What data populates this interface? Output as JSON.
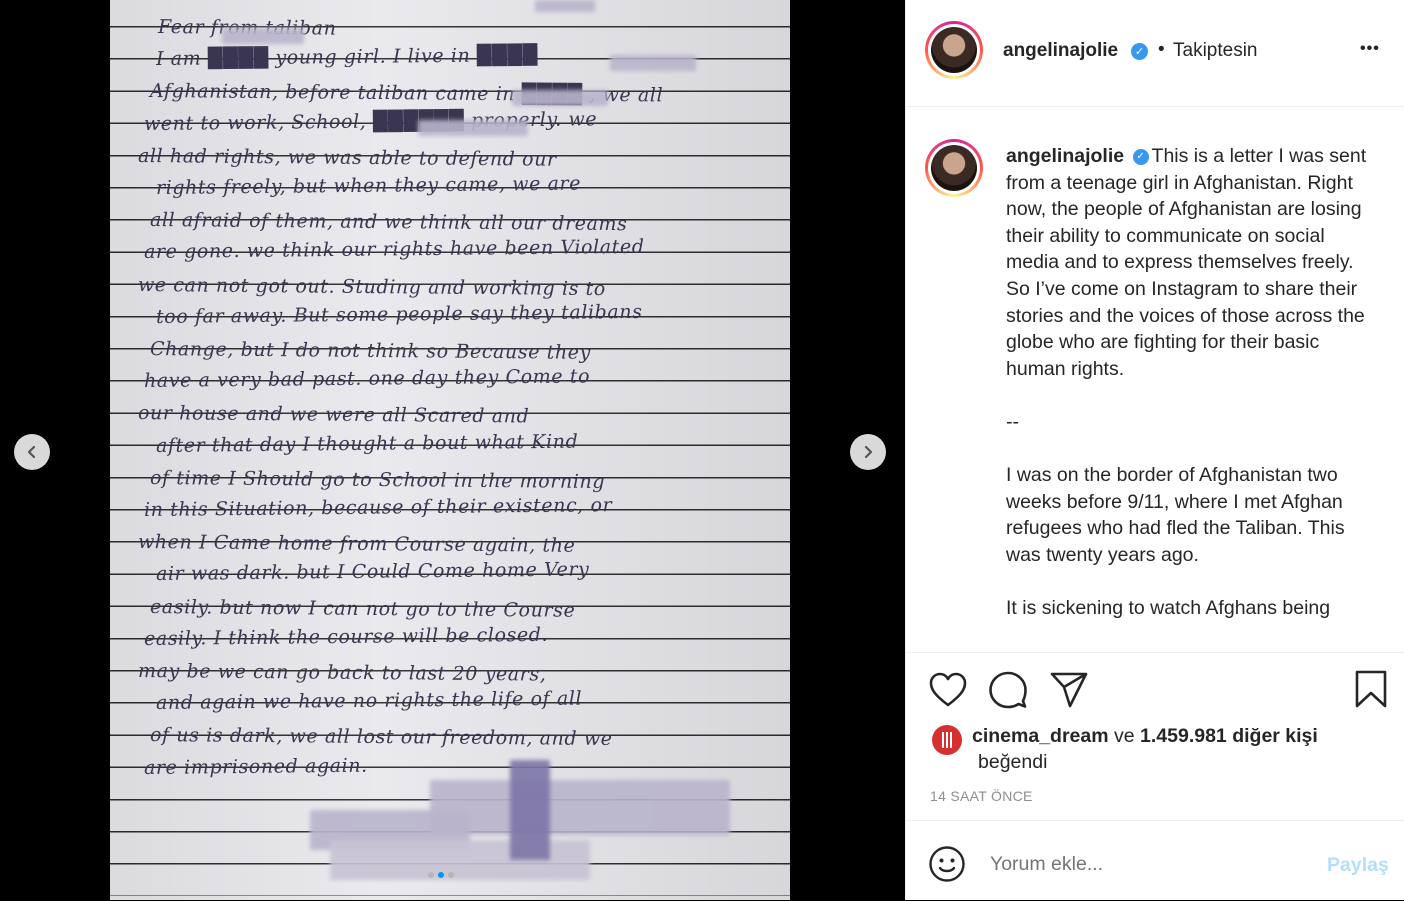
{
  "post": {
    "username": "angelinajolie",
    "follow_status": "Takiptesin",
    "more_label": "•••"
  },
  "handwriting": {
    "lines": [
      "Fear from taliban",
      "I am  ████  young girl. I live in ████",
      "Afghanistan, before taliban came in ████ , we all",
      "went to work, School, ██████ properly. we",
      "all had rights, we was able to defend our",
      "rights freely, but when they came, we are",
      "all afraid of them, and we think all our dreams",
      "are gone. we think our rights have been Violated",
      "we can not got out. Studing and working is to",
      "too far away. But some people say they talibans",
      "Change, but I do not think so Because they",
      "have a very bad past. one day they Come to",
      "our house and we were all Scared and",
      "after that day I thought a bout what Kind",
      "of time I Should go to School in the morning",
      "in this Situation, because of their existenc, or",
      "when I Came home from Course again, the",
      "air was dark. but I Could Come home Very",
      "easily. but now I can not go to the Course",
      "easily. I think the course will be closed.",
      "may be we can go back to last 20 years,",
      "and again we have no rights the life of all",
      "of us is dark, we all lost our freedom, and we",
      "are imprisoned again."
    ]
  },
  "caption": {
    "username": "angelinajolie",
    "paragraphs": [
      "This is a letter I was sent from a teenage girl in Afghanistan. Right now, the people of Afghanistan are losing their ability to communicate on social media and to express themselves freely. So I’ve come on Instagram to share their stories and the voices of those across the globe who are fighting for their basic human rights.",
      "--",
      "I was on the border of Afghanistan two weeks before 9/11, where I met Afghan refugees who had fled the Taliban. This was twenty years ago.",
      "It is sickening to watch Afghans being"
    ]
  },
  "likes": {
    "liker": "cinema_dream",
    "conjunction": "ve",
    "count_text": "1.459.981 diğer kişi",
    "suffix": "beğendi"
  },
  "timestamp": "14 SAAT ÖNCE",
  "comment": {
    "placeholder": "Yorum ekle...",
    "post_label": "Paylaş"
  },
  "carousel": {
    "total": 3,
    "active_index": 1
  },
  "colors": {
    "verified": "#3897f0",
    "post_button": "#b2dffc",
    "carousel_active_dot": "#0095f6"
  }
}
